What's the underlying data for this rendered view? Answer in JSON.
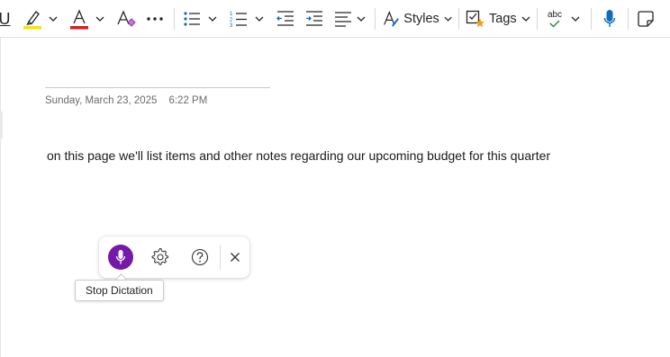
{
  "toolbar": {
    "underline_label": "U",
    "styles_label": "Styles",
    "tags_label": "Tags",
    "spelling_label": "abc",
    "highlight_color": "#f5e600",
    "font_color": "#e01b1b",
    "accent_color": "#0f6cbd",
    "tag_star_color": "#f29b1d",
    "check_color": "#2e8b3d",
    "icons": [
      "underline-icon",
      "highlighter-icon",
      "font-color-icon",
      "clear-formatting-icon",
      "more-icon",
      "bullets-icon",
      "numbering-icon",
      "decrease-indent-icon",
      "increase-indent-icon",
      "align-icon",
      "styles-icon",
      "tags-icon",
      "spelling-icon",
      "dictate-icon",
      "sticky-note-icon"
    ]
  },
  "note": {
    "date": "Sunday, March 23, 2025",
    "time": "6:22 PM",
    "body": "on this page we'll list items and other notes regarding our upcoming budget for this quarter"
  },
  "dictation": {
    "tooltip": "Stop Dictation",
    "mic_color": "#7619a8",
    "icons": [
      "mic-icon",
      "settings-icon",
      "help-icon",
      "close-icon"
    ]
  }
}
